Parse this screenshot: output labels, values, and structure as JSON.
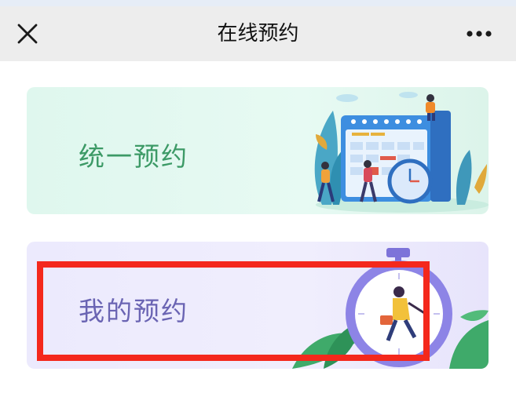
{
  "navbar": {
    "title": "在线预约",
    "close_icon": "close-icon",
    "more_icon": "more-dots-icon"
  },
  "cards": [
    {
      "label": "统一预约",
      "icon": "calendar-illustration",
      "accent": "#3c9a66"
    },
    {
      "label": "我的预约",
      "icon": "stopwatch-illustration",
      "accent": "#6a64b3"
    }
  ],
  "highlight": {
    "color": "#f4281c"
  }
}
